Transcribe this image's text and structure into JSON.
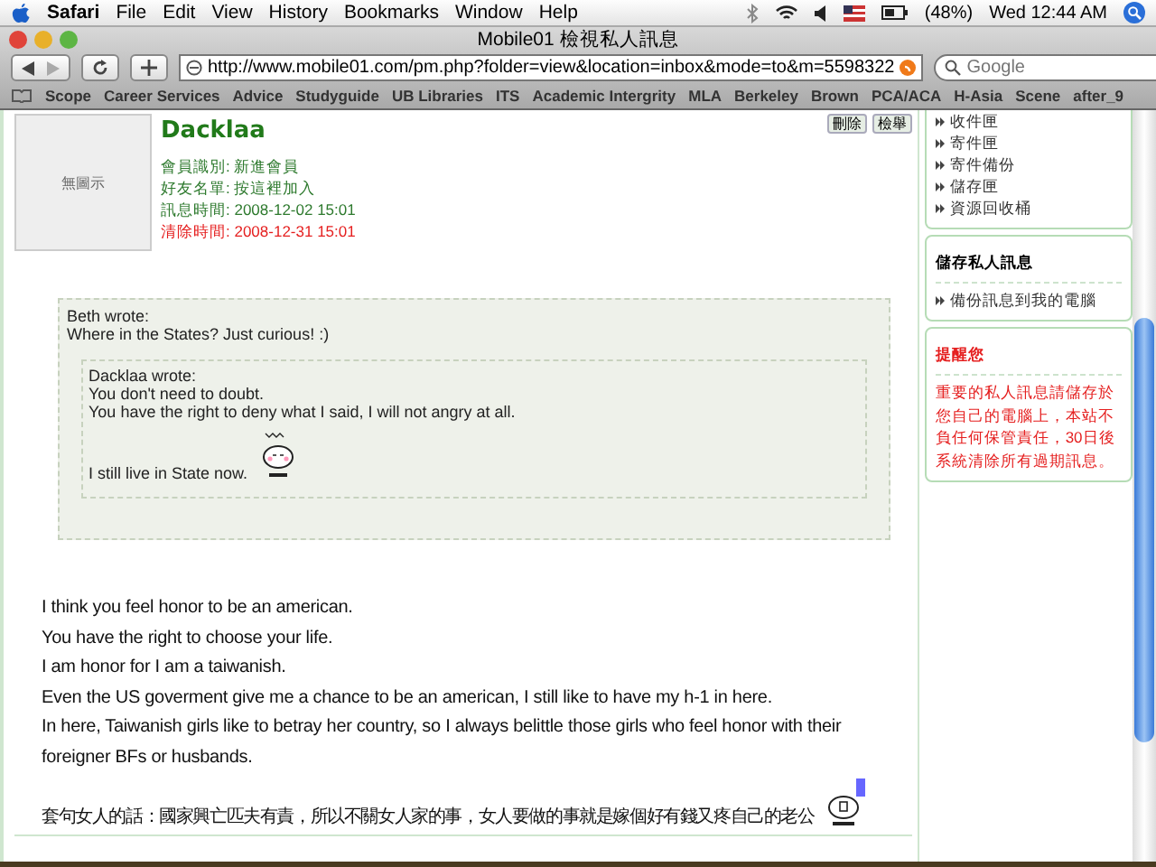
{
  "menubar": {
    "app": "Safari",
    "menus": [
      "File",
      "Edit",
      "View",
      "History",
      "Bookmarks",
      "Window",
      "Help"
    ],
    "battery": "(48%)",
    "clock": "Wed 12:44 AM"
  },
  "window": {
    "title": "Mobile01 檢視私人訊息"
  },
  "toolbar": {
    "url": "http://www.mobile01.com/pm.php?folder=view&location=inbox&mode=to&m=5598322",
    "search_placeholder": "Google"
  },
  "bookmarks": [
    "Scope",
    "Career Services",
    "Advice",
    "Studyguide",
    "UB Libraries",
    "ITS",
    "Academic Intergrity",
    "MLA",
    "Berkeley",
    "Brown",
    "PCA/ACA",
    "H-Asia",
    "Scene",
    "after_9"
  ],
  "message": {
    "sender": "Dacklaa",
    "avatar": "無圖示",
    "actions": [
      "刪除",
      "檢舉"
    ],
    "info": [
      {
        "label": "會員識別:",
        "value": "新進會員",
        "kind": "normal"
      },
      {
        "label": "好友名單:",
        "value": "按這裡加入",
        "kind": "normal"
      },
      {
        "label": "訊息時間:",
        "value": "2008-12-02 15:01",
        "kind": "normal"
      },
      {
        "label": "清除時間:",
        "value": "2008-12-31 15:01",
        "kind": "warning"
      }
    ],
    "quote": {
      "author": "Beth wrote:",
      "text": "Where in the States? Just curious! :)",
      "inner": {
        "author": "Dacklaa wrote:",
        "lines": [
          "You don't need to doubt.",
          "You have the right to deny what I said, I will not angry at all."
        ],
        "last": "I still live in State now."
      }
    },
    "body": [
      "I think you feel honor to be an american.",
      "You have the right to choose your life.",
      "I am honor for I am a taiwanish.",
      "Even the US goverment give me a chance to be an american, I still like to have my h-1 in here.",
      "In here, Taiwanish girls like to betray her country, so I always belittle those girls who feel honor with their foreigner BFs or husbands."
    ],
    "closing": "套句女人的話：國家興亡匹夫有責，所以不關女人家的事，女人要做的事就是嫁個好有錢又疼自己的老公"
  },
  "sidebar": {
    "folders": [
      "收件匣",
      "寄件匣",
      "寄件備份",
      "儲存匣",
      "資源回收桶"
    ],
    "save": {
      "title": "儲存私人訊息",
      "links": [
        "備份訊息到我的電腦"
      ]
    },
    "notice": {
      "title": "提醒您",
      "text": "重要的私人訊息請儲存於您自己的電腦上，本站不負任何保管責任，30日後系統清除所有過期訊息。"
    }
  }
}
